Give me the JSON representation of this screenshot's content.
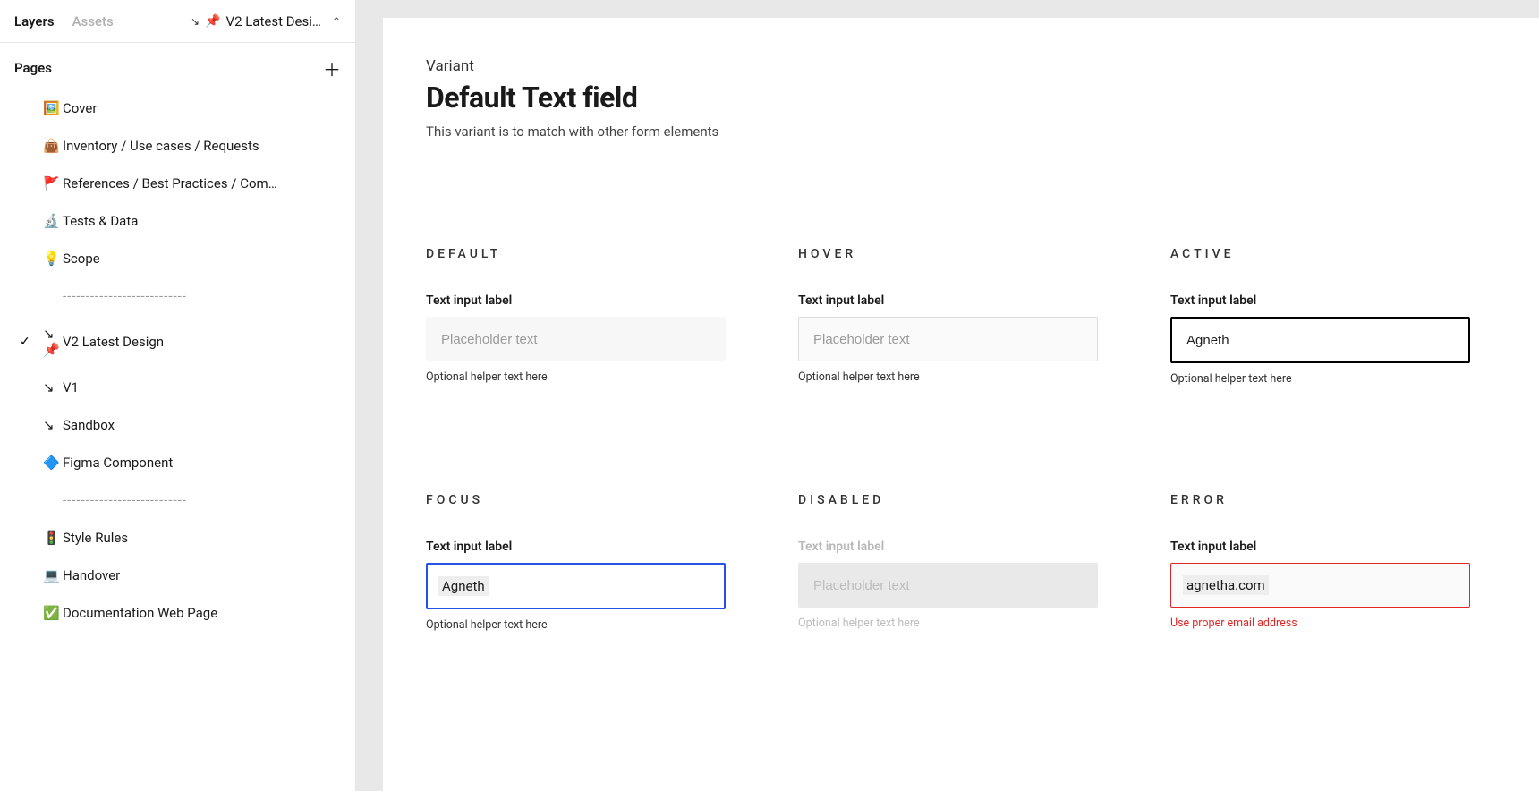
{
  "sidebar": {
    "tabs": {
      "layers": "Layers",
      "assets": "Assets"
    },
    "pageSelector": "V2 Latest Desi…",
    "pagesHeading": "Pages",
    "pages": [
      {
        "emoji": "🖼️",
        "label": "Cover"
      },
      {
        "emoji": "👜",
        "label": "Inventory / Use cases / Requests"
      },
      {
        "emoji": "🚩",
        "label": "References  / Best Practices / Com…"
      },
      {
        "emoji": "🔬",
        "label": "Tests & Data"
      },
      {
        "emoji": "💡",
        "label": "Scope"
      },
      {
        "emoji": "",
        "label": "---------------------------",
        "divider": true
      },
      {
        "emoji": "↘ 📌",
        "label": "V2  Latest Design",
        "active": true
      },
      {
        "emoji": "↘",
        "label": "V1"
      },
      {
        "emoji": "↘",
        "label": "Sandbox"
      },
      {
        "emoji": "🔷",
        "label": "Figma Component"
      },
      {
        "emoji": "",
        "label": "---------------------------",
        "divider": true
      },
      {
        "emoji": "🚦",
        "label": "Style Rules"
      },
      {
        "emoji": "💻",
        "label": "Handover"
      },
      {
        "emoji": "✅",
        "label": "Documentation Web Page"
      }
    ]
  },
  "canvas": {
    "eyebrow": "Variant",
    "title": "Default Text field",
    "description": "This variant is to match with other form elements",
    "states": {
      "default": {
        "heading": "DEFAULT",
        "label": "Text input label",
        "placeholder": "Placeholder text",
        "value": "",
        "helper": "Optional helper text here"
      },
      "hover": {
        "heading": "HOVER",
        "label": "Text input label",
        "placeholder": "Placeholder text",
        "value": "",
        "helper": "Optional helper text here"
      },
      "active": {
        "heading": "ACTIVE",
        "label": "Text input label",
        "placeholder": "",
        "value": "Agneth",
        "helper": "Optional helper text here"
      },
      "focus": {
        "heading": "FOCUS",
        "label": "Text input label",
        "placeholder": "",
        "value": "Agneth",
        "helper": "Optional helper text here"
      },
      "disabled": {
        "heading": "DISABLED",
        "label": "Text input label",
        "placeholder": "Placeholder text",
        "value": "",
        "helper": "Optional helper text here"
      },
      "error": {
        "heading": "ERROR",
        "label": "Text input label",
        "placeholder": "",
        "value": "agnetha.com",
        "helper": "Use proper email address"
      }
    }
  }
}
